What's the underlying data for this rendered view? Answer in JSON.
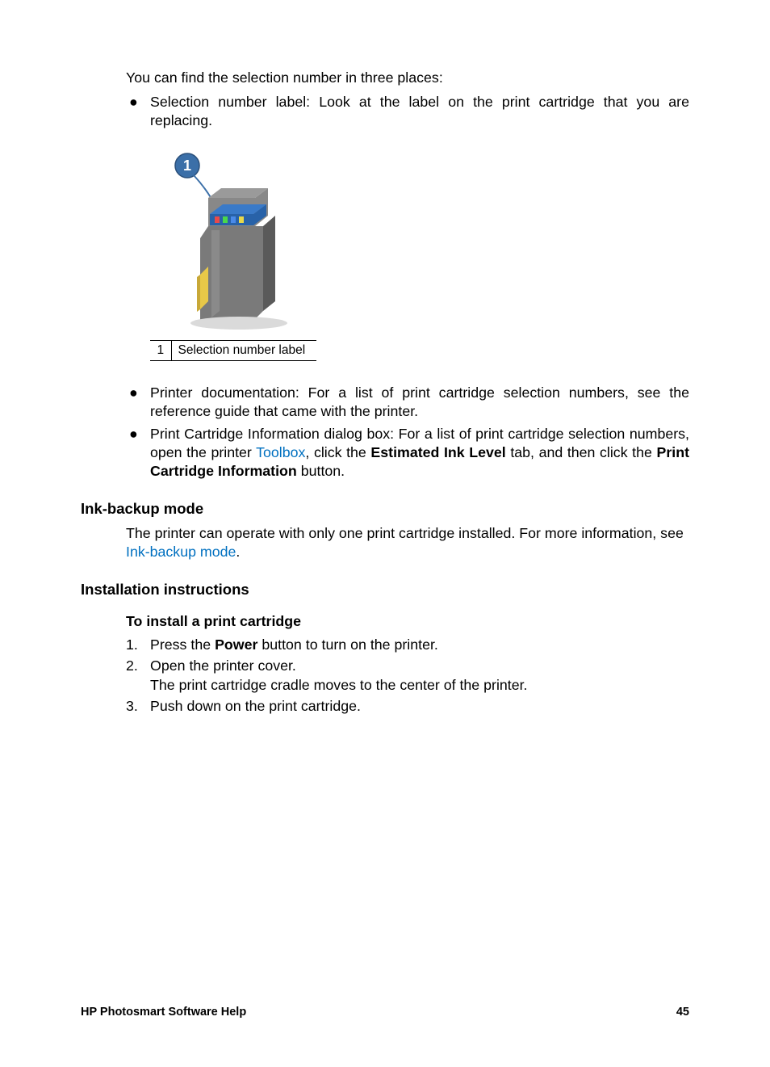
{
  "intro": "You can find the selection number in three places:",
  "bullet1": "Selection number label: Look at the label on the print cartridge that you are replacing.",
  "caption": {
    "num": "1",
    "label": "Selection number label"
  },
  "bullet2": "Printer documentation: For a list of print cartridge selection numbers, see the reference guide that came with the printer.",
  "bullet3_pre": "Print Cartridge Information dialog box: For a list of print cartridge selection numbers, open the printer ",
  "bullet3_link": "Toolbox",
  "bullet3_mid1": ", click the ",
  "bullet3_bold1": "Estimated Ink Level",
  "bullet3_mid2": " tab, and then click the ",
  "bullet3_bold2": "Print Cartridge Information",
  "bullet3_end": " button.",
  "section1_heading": "Ink-backup mode",
  "section1_body_pre": "The printer can operate with only one print cartridge installed. For more information, see ",
  "section1_body_link": "Ink-backup mode",
  "section1_body_end": ".",
  "section2_heading": "Installation instructions",
  "section2_subheading": "To install a print cartridge",
  "steps": [
    {
      "num": "1.",
      "pre": "Press the ",
      "bold": "Power",
      "post": " button to turn on the printer."
    },
    {
      "num": "2.",
      "line1": "Open the printer cover.",
      "line2": "The print cartridge cradle moves to the center of the printer."
    },
    {
      "num": "3.",
      "text": "Push down on the print cartridge."
    }
  ],
  "footer_left": "HP Photosmart Software Help",
  "footer_right": "45"
}
